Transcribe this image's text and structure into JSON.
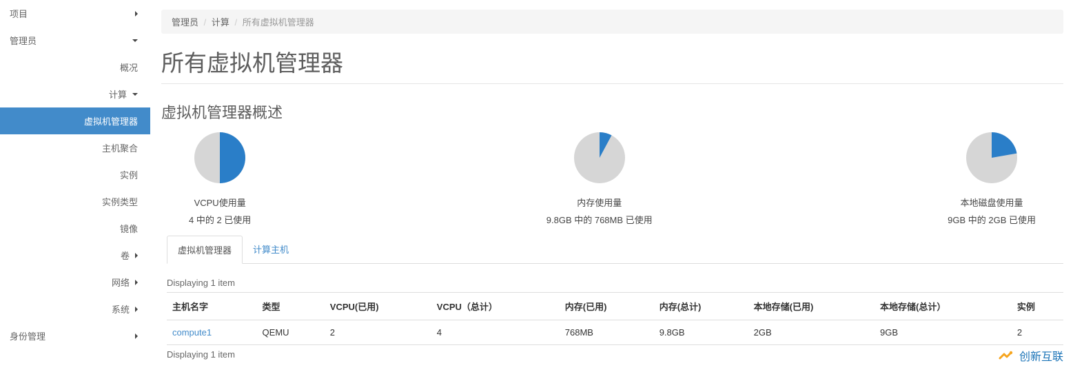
{
  "sidebar": {
    "project": "项目",
    "admin": "管理员",
    "overview": "概况",
    "compute": "计算",
    "hypervisors": "虚拟机管理器",
    "host_aggregates": "主机聚合",
    "instances": "实例",
    "flavors": "实例类型",
    "images": "镜像",
    "volumes": "卷",
    "network": "网络",
    "system": "系统",
    "identity": "身份管理"
  },
  "breadcrumb": {
    "a": "管理员",
    "b": "计算",
    "c": "所有虚拟机管理器"
  },
  "page_title": "所有虚拟机管理器",
  "section_title": "虚拟机管理器概述",
  "chart_data": [
    {
      "type": "pie",
      "label": "VCPU使用量",
      "sub": "4 中的 2 已使用",
      "used": 2,
      "total": 4
    },
    {
      "type": "pie",
      "label": "内存使用量",
      "sub": "9.8GB 中的 768MB 已使用",
      "used": 0.768,
      "total": 9.8
    },
    {
      "type": "pie",
      "label": "本地磁盘使用量",
      "sub": "9GB 中的 2GB 已使用",
      "used": 2,
      "total": 9
    }
  ],
  "tabs": {
    "hypervisor": "虚拟机管理器",
    "compute_host": "计算主机"
  },
  "table": {
    "caption_top": "Displaying 1 item",
    "caption_bottom": "Displaying 1 item",
    "headers": {
      "hostname": "主机名字",
      "type": "类型",
      "vcpu_used": "VCPU(已用)",
      "vcpu_total": "VCPU（总计）",
      "ram_used": "内存(已用)",
      "ram_total": "内存(总计)",
      "storage_used": "本地存储(已用)",
      "storage_total": "本地存储(总计）",
      "instances": "实例"
    },
    "rows": [
      {
        "hostname": "compute1",
        "type": "QEMU",
        "vcpu_used": "2",
        "vcpu_total": "4",
        "ram_used": "768MB",
        "ram_total": "9.8GB",
        "storage_used": "2GB",
        "storage_total": "9GB",
        "instances": "2"
      }
    ]
  },
  "brand": "创新互联",
  "colors": {
    "used": "#2a7ec8",
    "free": "#d6d6d6"
  }
}
